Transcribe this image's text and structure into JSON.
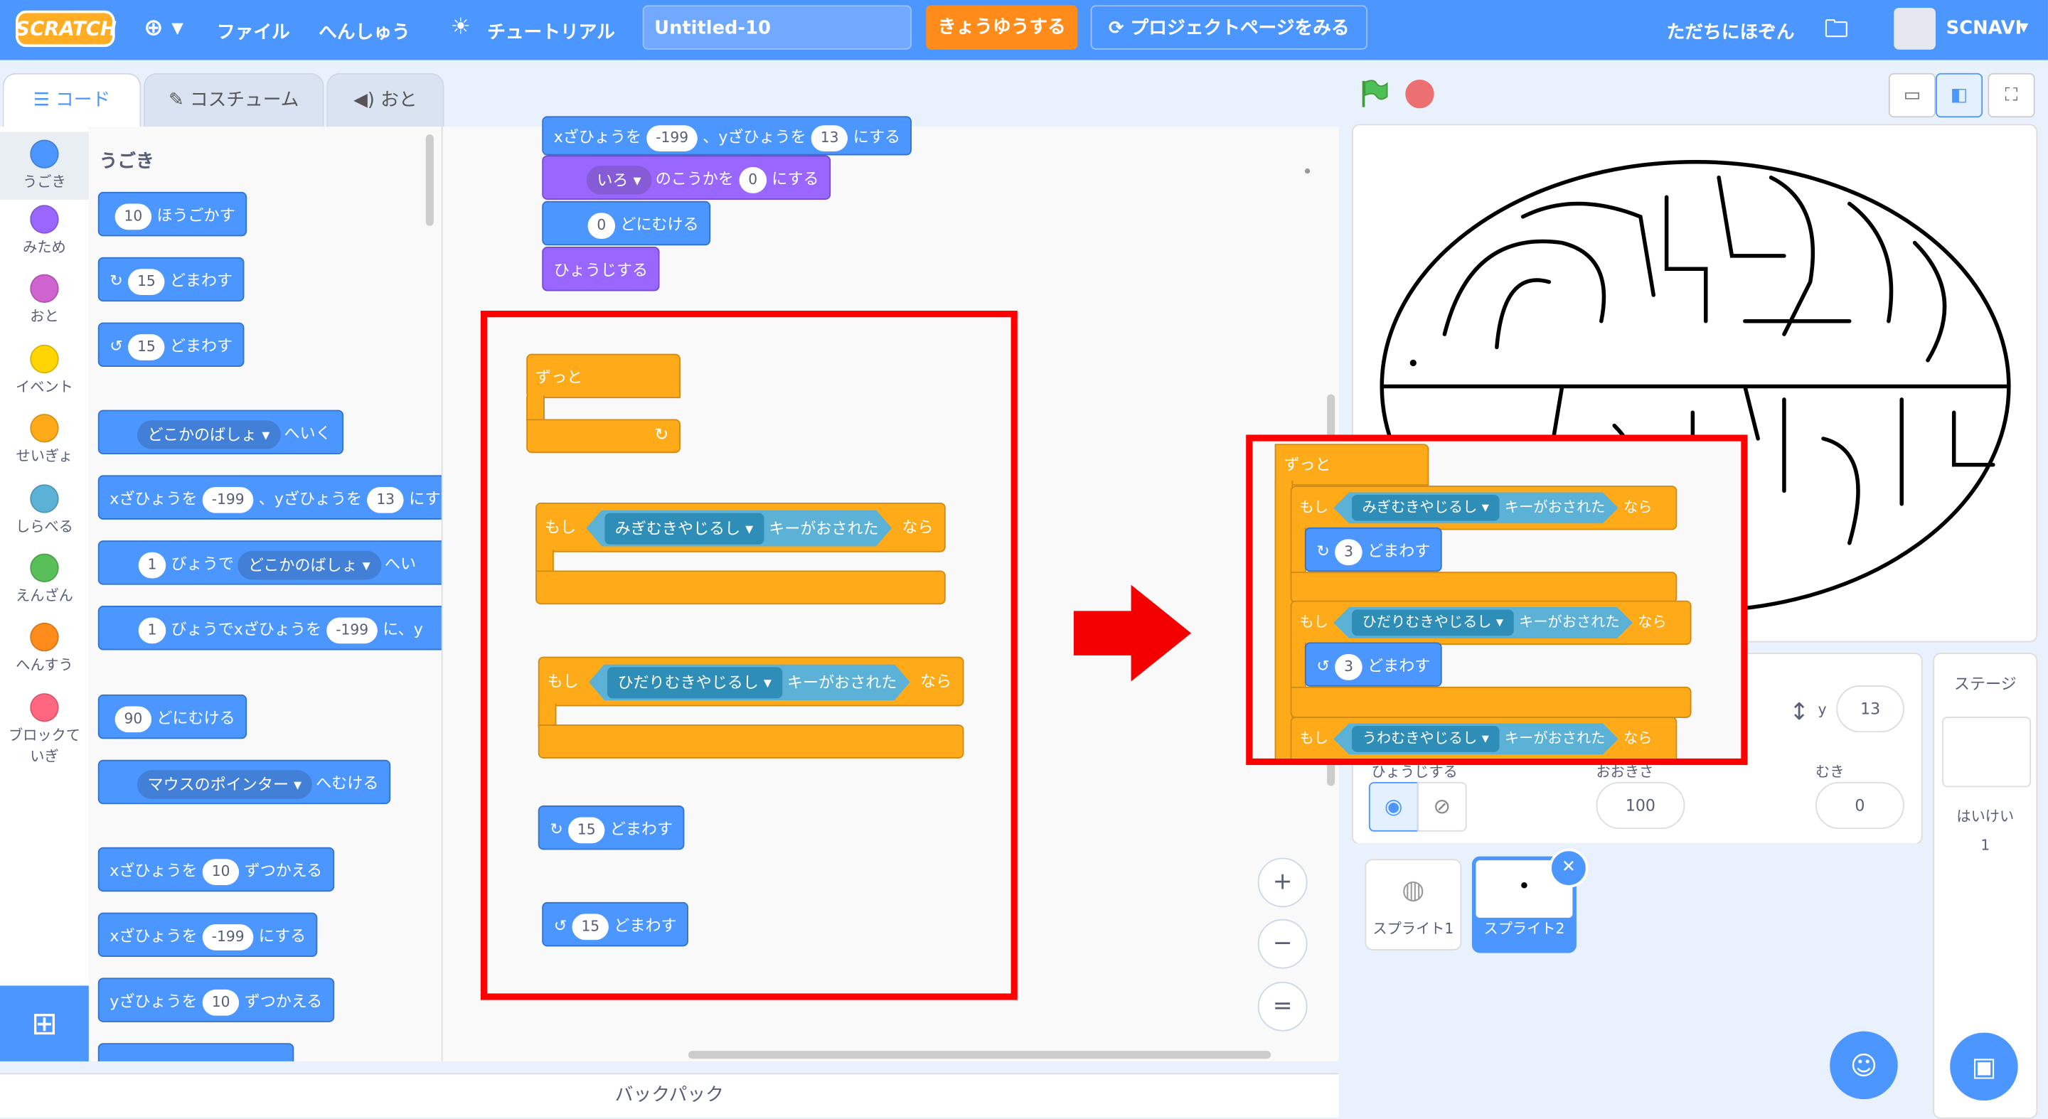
{
  "menu": {
    "logo": "SCRATCH",
    "file": "ファイル",
    "edit": "へんしゅう",
    "tutorial": "チュートリアル",
    "project_title": "Untitled-10",
    "share": "きょうゆうする",
    "see_project": "プロジェクトページをみる",
    "save_now": "ただちにほぞん",
    "user": "SCNAVI"
  },
  "tabs": {
    "code": "コード",
    "costume": "コスチューム",
    "sound": "おと"
  },
  "categories": [
    {
      "label": "うごき",
      "color": "#4c97ff"
    },
    {
      "label": "みため",
      "color": "#9966ff"
    },
    {
      "label": "おと",
      "color": "#cf63cf"
    },
    {
      "label": "イベント",
      "color": "#ffd500"
    },
    {
      "label": "せいぎょ",
      "color": "#ffab19"
    },
    {
      "label": "しらべる",
      "color": "#5cb1d6"
    },
    {
      "label": "えんざん",
      "color": "#59c059"
    },
    {
      "label": "へんすう",
      "color": "#ff8c1a"
    },
    {
      "label": "ブロックていぎ",
      "color": "#ff6680"
    }
  ],
  "palette": {
    "heading": "うごき",
    "move": {
      "n": "10",
      "t": "ほうごかす"
    },
    "turn_r": {
      "n": "15",
      "t": "どまわす"
    },
    "turn_l": {
      "n": "15",
      "t": "どまわす"
    },
    "goto": {
      "dd": "どこかのばしょ",
      "t": "へいく"
    },
    "gotoxy": {
      "a": "xざひょうを",
      "x": "-199",
      "b": "、yざひょうを",
      "y": "13",
      "c": "にす"
    },
    "glide": {
      "n": "1",
      "a": "びょうで",
      "dd": "どこかのばしょ",
      "b": "へい"
    },
    "glidexy": {
      "n": "1",
      "a": "びょうでxざひょうを",
      "x": "-199",
      "b": "に、y"
    },
    "point": {
      "n": "90",
      "t": "どにむける"
    },
    "towards": {
      "dd": "マウスのポインター",
      "t": "へむける"
    },
    "changex": {
      "a": "xざひょうを",
      "n": "10",
      "b": "ずつかえる"
    },
    "setx": {
      "a": "xざひょうを",
      "n": "-199",
      "b": "にする"
    },
    "changey": {
      "a": "yざひょうを",
      "n": "10",
      "b": "ずつかえる"
    }
  },
  "workspace": {
    "top_gotoxy": {
      "a": "xざひょうを",
      "x": "-199",
      "b": "、yざひょうを",
      "y": "13",
      "c": "にする"
    },
    "seteffect": {
      "dd": "いろ",
      "a": "のこうかを",
      "n": "0",
      "b": "にする"
    },
    "pointdir": {
      "n": "0",
      "t": "どにむける"
    },
    "show": "ひょうじする",
    "forever": "ずっと",
    "if1": {
      "if": "もし",
      "key": "みぎむきやじるし",
      "pressed": "キーがおされた",
      "then": "なら"
    },
    "if2": {
      "if": "もし",
      "key": "ひだりむきやじるし",
      "pressed": "キーがおされた",
      "then": "なら"
    },
    "turn_r": {
      "n": "15",
      "t": "どまわす"
    },
    "turn_l": {
      "n": "15",
      "t": "どまわす"
    },
    "zoom_in": "+",
    "zoom_out": "−",
    "zoom_reset": "="
  },
  "result": {
    "forever": "ずっと",
    "if1": {
      "if": "もし",
      "key": "みぎむきやじるし",
      "pressed": "キーがおされた",
      "then": "なら",
      "n": "3",
      "t": "どまわす"
    },
    "if2": {
      "if": "もし",
      "key": "ひだりむきやじるし",
      "pressed": "キーがおされた",
      "then": "なら",
      "n": "3",
      "t": "どまわす"
    },
    "if3": {
      "if": "もし",
      "key": "うわむきやじるし",
      "pressed": "キーがおされた",
      "then": "なら"
    }
  },
  "backpack": "バックパック",
  "sprite_info": {
    "y_label": "y",
    "y_value": "13",
    "show_label": "ひょうじする",
    "size_label": "おおきさ",
    "size_value": "100",
    "direction_label": "むき",
    "direction_value": "0"
  },
  "sprites": [
    {
      "name": "スプライト1"
    },
    {
      "name": "スプライト2"
    }
  ],
  "stage_panel": {
    "title": "ステージ",
    "backdrops_label": "はいけい",
    "backdrops_count": "1"
  },
  "colors": {
    "menu": "#4c97ff",
    "motion": "#4c97ff",
    "control": "#ffab19",
    "looks": "#9966ff",
    "sensing": "#5cb1d6",
    "highlight": "#ff0000"
  }
}
